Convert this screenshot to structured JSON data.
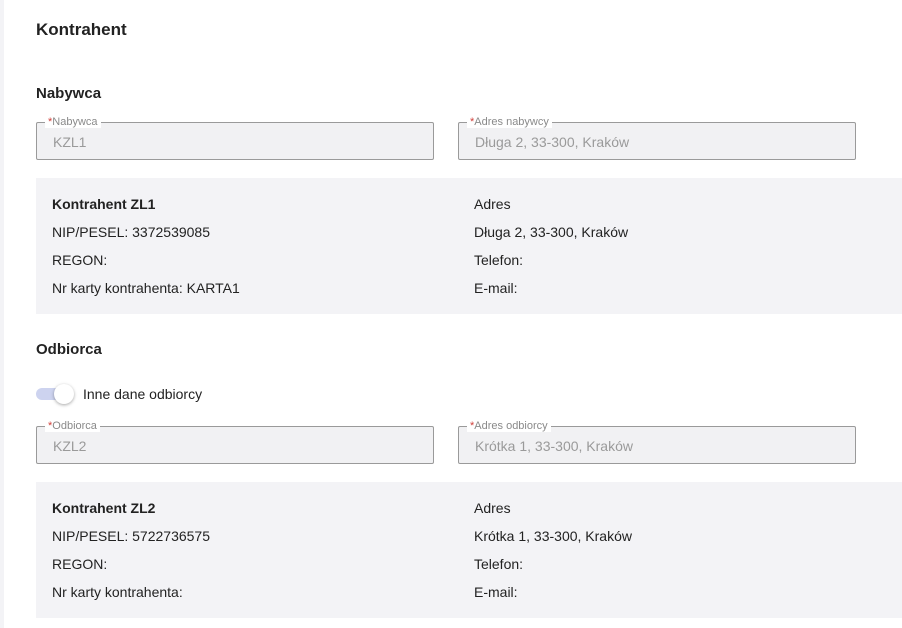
{
  "page": {
    "title": "Kontrahent"
  },
  "buyer": {
    "section_title": "Nabywca",
    "field_buyer": {
      "label": "Nabywca",
      "required_mark": "*",
      "value": "KZL1"
    },
    "field_address": {
      "label": "Adres nabywcy",
      "required_mark": "*",
      "value": "Długa 2, 33-300, Kraków"
    },
    "card": {
      "name": "Kontrahent ZL1",
      "nip": "NIP/PESEL: 3372539085",
      "regon": "REGON:",
      "card_no": "Nr karty kontrahenta: KARTA1",
      "address_header": "Adres",
      "address": "Długa 2, 33-300, Kraków",
      "phone": "Telefon:",
      "email": "E-mail:"
    }
  },
  "recipient": {
    "section_title": "Odbiorca",
    "toggle_label": "Inne dane odbiorcy",
    "toggle_on": true,
    "field_recipient": {
      "label": "Odbiorca",
      "required_mark": "*",
      "value": "KZL2"
    },
    "field_address": {
      "label": "Adres odbiorcy",
      "required_mark": "*",
      "value": "Krótka 1, 33-300, Kraków"
    },
    "card": {
      "name": "Kontrahent ZL2",
      "nip": "NIP/PESEL: 5722736575",
      "regon": "REGON:",
      "card_no": "Nr karty kontrahenta:",
      "address_header": "Adres",
      "address": "Krótka 1, 33-300, Kraków",
      "phone": "Telefon:",
      "email": "E-mail:"
    }
  },
  "colors": {
    "required": "#d0403a",
    "toggle_track": "#cdd3ef",
    "card_bg": "#f3f3f6"
  }
}
